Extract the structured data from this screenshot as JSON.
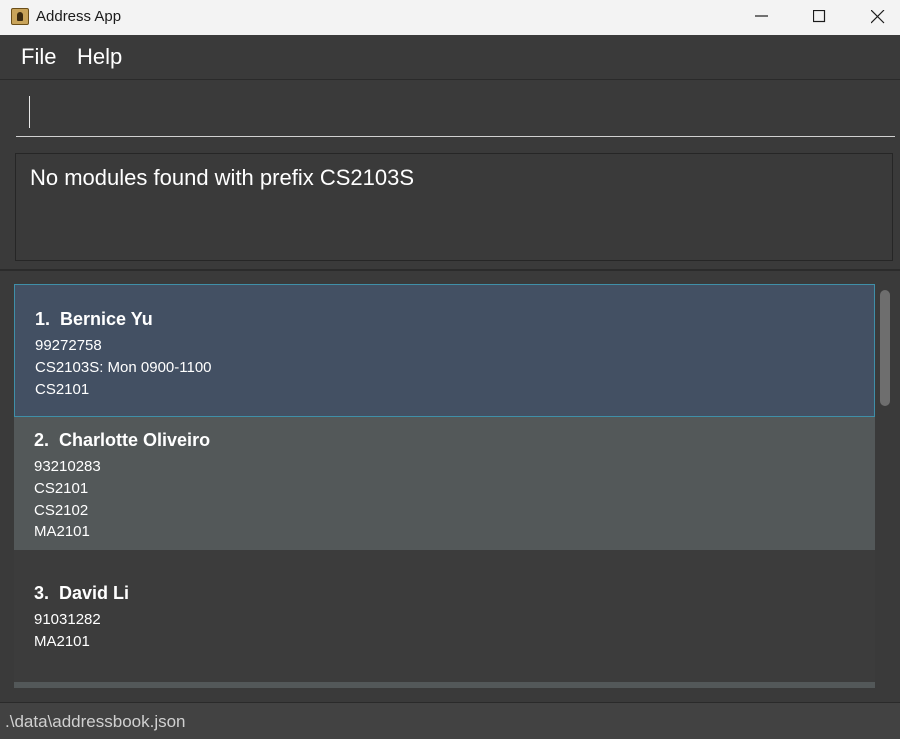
{
  "window": {
    "title": "Address App"
  },
  "menu": {
    "file": "File",
    "help": "Help"
  },
  "command": {
    "value": ""
  },
  "result": {
    "message": "No modules found with prefix CS2103S"
  },
  "persons": [
    {
      "index": "1.",
      "name": "Bernice Yu",
      "lines": [
        "99272758",
        "CS2103S: Mon 0900-1100",
        "CS2101"
      ]
    },
    {
      "index": "2.",
      "name": "Charlotte Oliveiro",
      "lines": [
        "93210283",
        "CS2101",
        "CS2102",
        "MA2101"
      ]
    },
    {
      "index": "3.",
      "name": "David Li",
      "lines": [
        "91031282",
        "MA2101"
      ]
    }
  ],
  "status": {
    "path": ".\\data\\addressbook.json"
  },
  "colors": {
    "selected_card": "#435063",
    "selected_border": "#3f8fa8",
    "alt_card": "#535859",
    "card": "#3c3c3c"
  }
}
